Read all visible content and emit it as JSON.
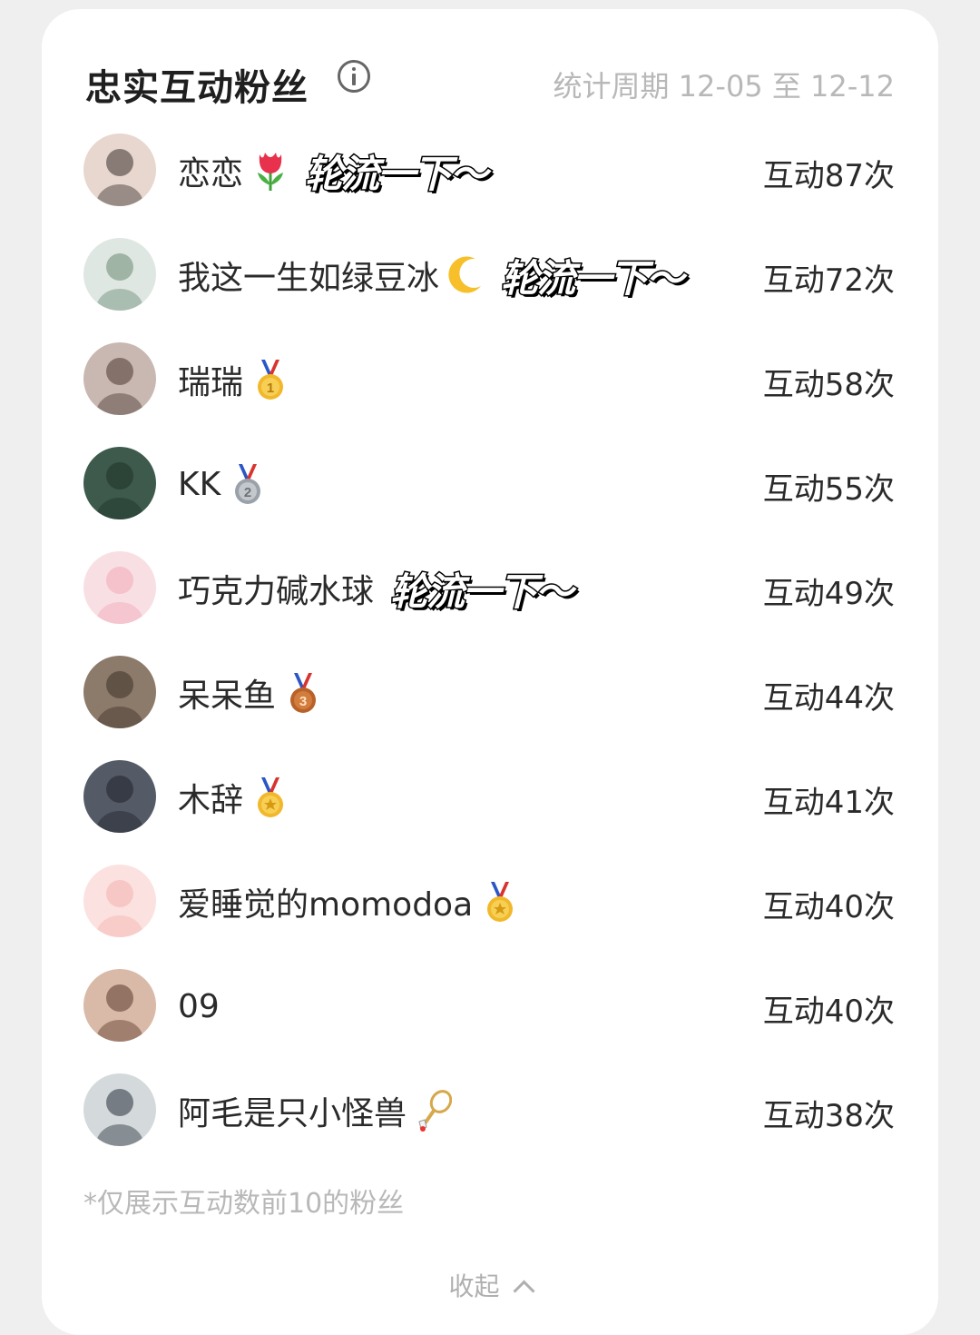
{
  "header": {
    "title": "忠实互动粉丝",
    "period": "统计周期 12-05 至 12-12"
  },
  "fans": [
    {
      "name": "恋恋",
      "emoji": "tulip-icon",
      "slogan": "轮流一下～",
      "count": "互动87次",
      "avatar_color": "#e7d7cf"
    },
    {
      "name": "我这一生如绿豆冰",
      "emoji": "crescent-moon-icon",
      "slogan": "轮流一下～",
      "count": "互动72次",
      "avatar_color": "#dfe7e2"
    },
    {
      "name": "瑞瑞",
      "emoji": "gold-medal-icon",
      "slogan": "",
      "count": "互动58次",
      "avatar_color": "#c9b8b2"
    },
    {
      "name": "KK",
      "emoji": "silver-medal-icon",
      "slogan": "",
      "count": "互动55次",
      "avatar_color": "#3d5a4d"
    },
    {
      "name": "巧克力碱水球",
      "emoji": "",
      "slogan": "轮流一下～",
      "count": "互动49次",
      "avatar_color": "#f8dfe3"
    },
    {
      "name": "呆呆鱼",
      "emoji": "bronze-medal-icon",
      "slogan": "",
      "count": "互动44次",
      "avatar_color": "#8c7a6b"
    },
    {
      "name": "木辞",
      "emoji": "sports-medal-icon",
      "slogan": "",
      "count": "互动41次",
      "avatar_color": "#545a66"
    },
    {
      "name": "爱睡觉的momodoa",
      "emoji": "sports-medal-icon",
      "slogan": "",
      "count": "互动40次",
      "avatar_color": "#fbe1df"
    },
    {
      "name": "09",
      "emoji": "",
      "slogan": "",
      "count": "互动40次",
      "avatar_color": "#d9b9a7"
    },
    {
      "name": "阿毛是只小怪兽",
      "emoji": "badminton-icon",
      "slogan": "",
      "count": "互动38次",
      "avatar_color": "#d4d9dc"
    }
  ],
  "footnote": "*仅展示互动数前10的粉丝",
  "collapse_label": "收起"
}
